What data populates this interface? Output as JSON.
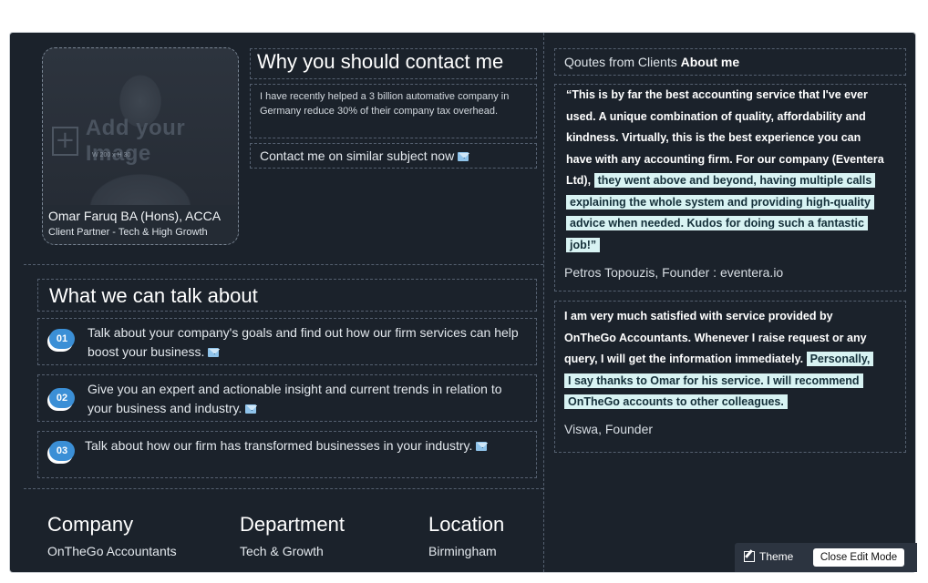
{
  "profile": {
    "image_placeholder": "Add your Image",
    "image_size_hint": "W 200 x H 30",
    "name": "Omar Faruq BA (Hons), ACCA",
    "role": "Client Partner - Tech & High Growth"
  },
  "why_contact": {
    "title": "Why you should contact me",
    "body": "I have recently helped a 3 billion automative company in Germany reduce 30% of their company tax overhead.",
    "cta": "Contact me on similar subject now"
  },
  "talk": {
    "title": "What we can talk about",
    "topics": [
      {
        "num": "01",
        "text": "Talk about your company's goals and find out how our firm services can help boost your business."
      },
      {
        "num": "02",
        "text": "Give you an expert and actionable insight and current trends in relation to your business and industry."
      },
      {
        "num": "03",
        "text": "Talk about how our firm has transformed businesses in your industry."
      }
    ]
  },
  "info": {
    "company_label": "Company",
    "company_value": "OnTheGo Accountants",
    "department_label": "Department",
    "department_value": "Tech & Growth",
    "location_label": "Location",
    "location_value": "Birmingham"
  },
  "quotes": {
    "header_prefix": "Qoutes from Clients",
    "header_bold": "About me",
    "items": [
      {
        "plain": "“This is by far the best accounting service that I've ever used. A unique combination of quality, affordability and kindness. Virtually, this is the best experience you can have with any accounting firm. For our company (Eventera Ltd),",
        "highlight": "they went above and beyond, having multiple calls explaining the whole system and providing high-quality advice when needed. Kudos for doing such a fantastic job!”",
        "author": "Petros Topouzis, Founder : eventera.io"
      },
      {
        "plain": "I am very much satisfied with service provided by OnTheGo Accountants. Whenever I raise request or any query, I will get the information immediately.",
        "highlight": "Personally, I say thanks to Omar for his service. I will recommend OnTheGo accounts to other colleagues.",
        "author": "Viswa, Founder"
      }
    ]
  },
  "toolbar": {
    "theme_label": "Theme",
    "close_label": "Close Edit Mode"
  },
  "colors": {
    "background": "#1b222b",
    "badge": "#3b8fd6",
    "highlight": "#d8f3f3"
  }
}
